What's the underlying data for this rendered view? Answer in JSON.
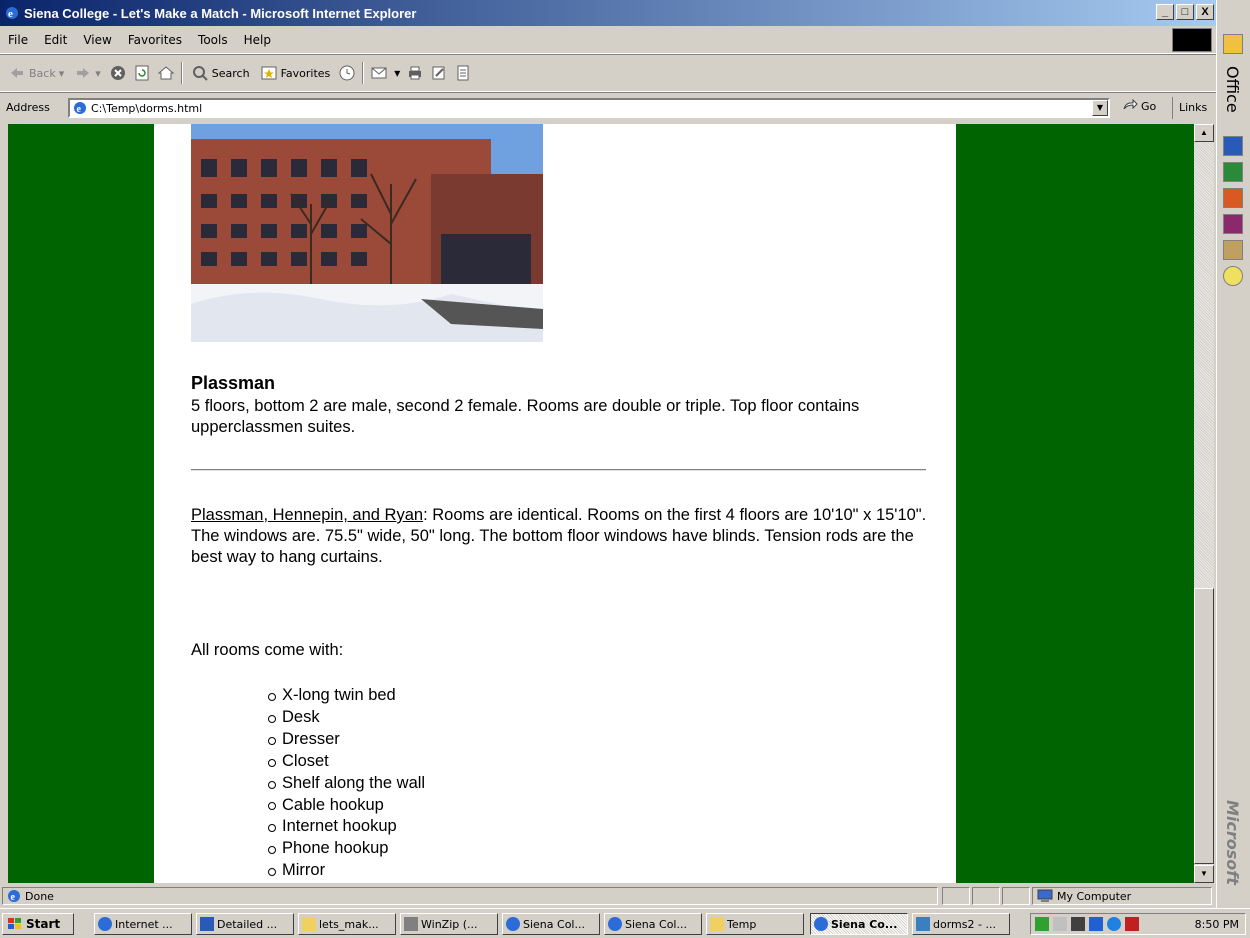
{
  "window": {
    "title": "Siena College - Let's Make a Match - Microsoft Internet Explorer",
    "buttons": [
      "_",
      "□",
      "X"
    ]
  },
  "menubar": [
    "File",
    "Edit",
    "View",
    "Favorites",
    "Tools",
    "Help"
  ],
  "toolbar": {
    "back": "Back",
    "search": "Search",
    "favorites": "Favorites"
  },
  "address": {
    "label": "Address",
    "value": "C:\\Temp\\dorms.html",
    "go": "Go",
    "links": "Links"
  },
  "content": {
    "photo_alt": "Plassman residence hall in winter",
    "title": "Plassman",
    "description": "5 floors, bottom 2 are male, second 2 female. Rooms are double or triple. Top floor contains upperclassmen suites.",
    "dims_link": "Plassman, Hennepin, and Ryan",
    "dims_text": ": Rooms are identical. Rooms on the first 4 floors are 10'10\" x 15'10\". The windows are. 75.5\" wide, 50\" long. The bottom floor windows have blinds. Tension rods are the best way to hang curtains.",
    "comes_with": "All rooms come with:",
    "amenities": [
      "X-long twin bed",
      "Desk",
      "Dresser",
      "Closet",
      "Shelf along the wall",
      "Cable hookup",
      "Internet hookup",
      "Phone hookup",
      "Mirror"
    ]
  },
  "status": {
    "text": "Done",
    "zone": "My Computer"
  },
  "officebar": {
    "label": "Office",
    "brand": "Microsoft",
    "icons": [
      "office-icon",
      "word-icon",
      "excel-icon",
      "powerpoint-icon",
      "access-icon",
      "outlook-icon",
      "help-icon"
    ]
  },
  "taskbar": {
    "start": "Start",
    "tasks": [
      "Internet ...",
      "Detailed ...",
      "lets_mak...",
      "WinZip (...",
      "Siena Col...",
      "Siena Col...",
      "Temp",
      "Siena Co...",
      "dorms2 - ..."
    ],
    "clock": "8:50 PM"
  },
  "colors": {
    "page_background": "#006400",
    "content_background": "#ffffff",
    "title_gradient_start": "#0a246a",
    "title_gradient_end": "#a6caf0"
  }
}
